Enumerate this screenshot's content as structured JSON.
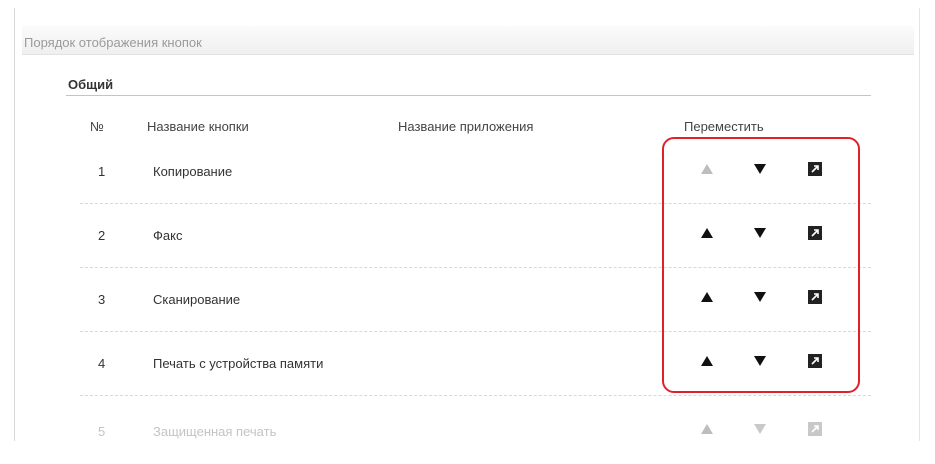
{
  "panel": {
    "title": "Порядок отображения кнопок"
  },
  "section": {
    "title": "Общий"
  },
  "columns": {
    "num": "№",
    "button_name": "Название кнопки",
    "app_name": "Название приложения",
    "move": "Переместить"
  },
  "rows": [
    {
      "num": "1",
      "name": "Копирование",
      "up_enabled": false,
      "down_enabled": true
    },
    {
      "num": "2",
      "name": "Факс",
      "up_enabled": true,
      "down_enabled": true
    },
    {
      "num": "3",
      "name": "Сканирование",
      "up_enabled": true,
      "down_enabled": true
    },
    {
      "num": "4",
      "name": "Печать с устройства памяти",
      "up_enabled": true,
      "down_enabled": true
    },
    {
      "num": "5",
      "name": "Защищенная печать",
      "up_enabled": true,
      "down_enabled": true
    }
  ],
  "icons": {
    "up": "arrow-up-icon",
    "down": "arrow-down-icon",
    "move": "move-to-position-icon"
  },
  "colors": {
    "highlight": "#e0212c",
    "disabled_icon": "#bdbdbd"
  }
}
